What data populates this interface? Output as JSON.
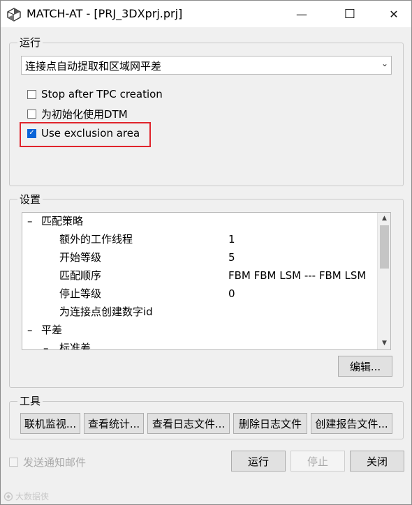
{
  "window": {
    "title": "MATCH-AT - [PRJ_3DXprj.prj]",
    "minimize_glyph": "—",
    "maximize_glyph": "☐",
    "close_glyph": "✕"
  },
  "run_group": {
    "label": "运行",
    "mode_select": {
      "value": "连接点自动提取和区域网平差",
      "arrow": "⌄"
    },
    "options": [
      {
        "label": "Stop after TPC creation",
        "checked": false
      },
      {
        "label": "为初始化使用DTM",
        "checked": false
      },
      {
        "label": "Use exclusion area",
        "checked": true
      }
    ],
    "highlight_color": "#e0242c"
  },
  "settings_group": {
    "label": "设置",
    "tree": [
      {
        "toggle": "–",
        "label": "匹配策略",
        "value": ""
      },
      {
        "toggle": "",
        "label": "额外的工作线程",
        "value": "1"
      },
      {
        "toggle": "",
        "label": "开始等级",
        "value": "5"
      },
      {
        "toggle": "",
        "label": "匹配顺序",
        "value": "FBM FBM LSM --- FBM LSM"
      },
      {
        "toggle": "",
        "label": "停止等级",
        "value": "0"
      },
      {
        "toggle": "",
        "label": "为连接点创建数字id",
        "value": ""
      },
      {
        "toggle": "–",
        "label": "平差",
        "value": ""
      },
      {
        "toggle": "–",
        "label": "标准差",
        "value": ""
      }
    ],
    "edit_button": "编辑..."
  },
  "tools_group": {
    "label": "工具",
    "buttons": [
      "联机监视...",
      "查看统计...",
      "查看日志文件...",
      "删除日志文件",
      "创建报告文件..."
    ]
  },
  "footer": {
    "notify_checkbox_label": "发送通知邮件",
    "run_button": "运行",
    "stop_button": "停止",
    "close_button": "关闭"
  },
  "watermark": "大数据侠",
  "colors": {
    "accent_check": "#0a64d8",
    "window_bg": "#f0f0f0"
  }
}
